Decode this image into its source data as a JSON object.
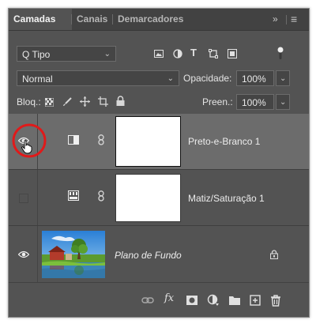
{
  "tabs": [
    {
      "label": "Camadas"
    },
    {
      "label": "Canais"
    },
    {
      "label": "Demarcadores"
    }
  ],
  "tab_controls": {
    "collapse": "»",
    "menu": "≡"
  },
  "filter": {
    "selected": "Q Tipo"
  },
  "blend": {
    "mode": "Normal",
    "opacity_label": "Opacidade:",
    "opacity_value": "100%"
  },
  "lock": {
    "label": "Bloq.:",
    "fill_label": "Preen.:",
    "fill_value": "100%"
  },
  "layers": [
    {
      "name": "Preto-e-Branco 1",
      "visible": true,
      "selected": true,
      "kind": "adjustment",
      "adjustment_icon": "black-white-icon"
    },
    {
      "name": "Matiz/Saturação 1",
      "visible": false,
      "selected": false,
      "kind": "adjustment",
      "adjustment_icon": "hue-saturation-icon"
    },
    {
      "name": "Plano de Fundo",
      "visible": true,
      "selected": false,
      "kind": "background",
      "locked": true
    }
  ],
  "colors": {
    "panel": "#535353",
    "selected_row": "#6c6c6c",
    "highlight_circle": "#e01a1a"
  }
}
